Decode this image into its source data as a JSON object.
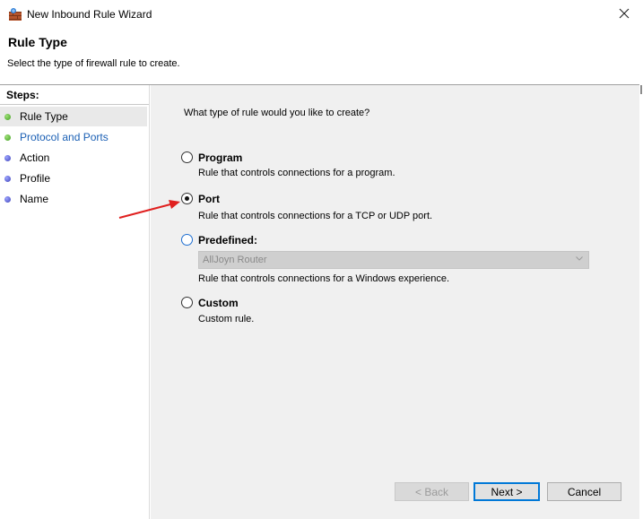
{
  "window": {
    "title": "New Inbound Rule Wizard"
  },
  "header": {
    "title": "Rule Type",
    "description": "Select the type of firewall rule to create."
  },
  "steps": {
    "title": "Steps:",
    "items": [
      {
        "label": "Rule Type",
        "status": "current",
        "dot_color": "#3f9f1d"
      },
      {
        "label": "Protocol and Ports",
        "status": "link",
        "dot_color": "#3f9f1d"
      },
      {
        "label": "Action",
        "status": "pending",
        "dot_color": "#3b3fb8"
      },
      {
        "label": "Profile",
        "status": "pending",
        "dot_color": "#3b3fb8"
      },
      {
        "label": "Name",
        "status": "pending",
        "dot_color": "#3b3fb8"
      }
    ]
  },
  "main": {
    "question": "What type of rule would you like to create?",
    "options": [
      {
        "label": "Program",
        "description": "Rule that controls connections for a program.",
        "selected": false
      },
      {
        "label": "Port",
        "description": "Rule that controls connections for a TCP or UDP port.",
        "selected": true
      },
      {
        "label": "Predefined:",
        "description": "Rule that controls connections for a Windows experience.",
        "selected": false,
        "dropdown_value": "AllJoyn Router"
      },
      {
        "label": "Custom",
        "description": "Custom rule.",
        "selected": false
      }
    ]
  },
  "buttons": {
    "back": "< Back",
    "next": "Next >",
    "cancel": "Cancel"
  },
  "icons": {
    "app": "firewall-icon",
    "close": "close-icon",
    "dropdown": "chevron-down-icon"
  },
  "colors": {
    "accent": "#0078d7",
    "link": "#1a5fb4",
    "annotation_arrow": "#e0201f"
  }
}
